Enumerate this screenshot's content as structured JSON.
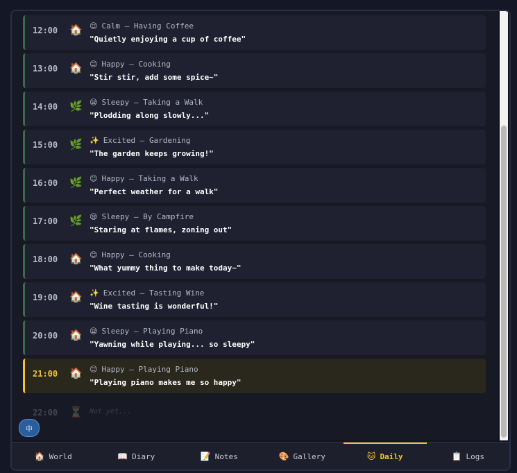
{
  "language_button": "中",
  "entries": [
    {
      "time": "12:00",
      "loc_icon": "🏠",
      "mood_icon": "😌",
      "mood": "Calm",
      "activity": "Having Coffee",
      "quote": "\"Quietly enjoying a cup of coffee\""
    },
    {
      "time": "13:00",
      "loc_icon": "🏠",
      "mood_icon": "😊",
      "mood": "Happy",
      "activity": "Cooking",
      "quote": "\"Stir stir, add some spice~\""
    },
    {
      "time": "14:00",
      "loc_icon": "🌿",
      "mood_icon": "😪",
      "mood": "Sleepy",
      "activity": "Taking a Walk",
      "quote": "\"Plodding along slowly...\""
    },
    {
      "time": "15:00",
      "loc_icon": "🌿",
      "mood_icon": "✨",
      "mood": "Excited",
      "activity": "Gardening",
      "quote": "\"The garden keeps growing!\""
    },
    {
      "time": "16:00",
      "loc_icon": "🌿",
      "mood_icon": "😊",
      "mood": "Happy",
      "activity": "Taking a Walk",
      "quote": "\"Perfect weather for a walk\""
    },
    {
      "time": "17:00",
      "loc_icon": "🌿",
      "mood_icon": "😪",
      "mood": "Sleepy",
      "activity": "By Campfire",
      "quote": "\"Staring at flames, zoning out\""
    },
    {
      "time": "18:00",
      "loc_icon": "🏠",
      "mood_icon": "😊",
      "mood": "Happy",
      "activity": "Cooking",
      "quote": "\"What yummy thing to make today~\""
    },
    {
      "time": "19:00",
      "loc_icon": "🏠",
      "mood_icon": "✨",
      "mood": "Excited",
      "activity": "Tasting Wine",
      "quote": "\"Wine tasting is wonderful!\""
    },
    {
      "time": "20:00",
      "loc_icon": "🏠",
      "mood_icon": "😪",
      "mood": "Sleepy",
      "activity": "Playing Piano",
      "quote": "\"Yawning while playing... so sleepy\""
    },
    {
      "time": "21:00",
      "loc_icon": "🏠",
      "mood_icon": "😊",
      "mood": "Happy",
      "activity": "Playing Piano",
      "quote": "\"Playing piano makes me so happy\""
    }
  ],
  "current_index": 9,
  "pending": {
    "time": "22:00",
    "icon": "⏳",
    "text": "Not yet..."
  },
  "tabs": [
    {
      "icon": "🏠",
      "label": "World"
    },
    {
      "icon": "📖",
      "label": "Diary"
    },
    {
      "icon": "📝",
      "label": "Notes"
    },
    {
      "icon": "🎨",
      "label": "Gallery"
    },
    {
      "icon": "🐱",
      "label": "Daily"
    },
    {
      "icon": "📋",
      "label": "Logs"
    }
  ],
  "active_tab": "Daily",
  "colors": {
    "accent": "#f2c230",
    "entry_border": "#3f6a4a",
    "background": "#171925"
  }
}
